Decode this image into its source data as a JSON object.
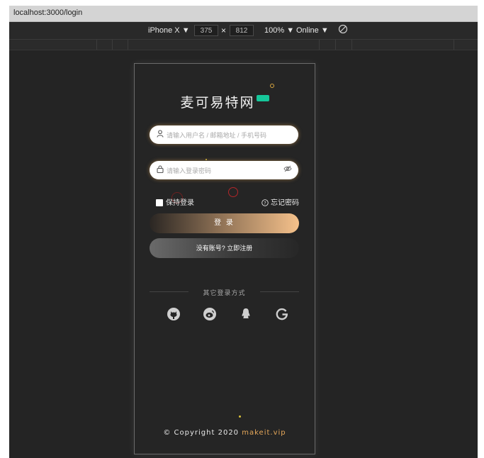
{
  "browser": {
    "url": "localhost:3000/login"
  },
  "devtools": {
    "device": "iPhone X ▼",
    "width": "375",
    "times": "×",
    "height": "812",
    "zoom": "100% ▼",
    "network": "Online ▼"
  },
  "app": {
    "brand": "麦可易特网",
    "username_placeholder": "请输入用户名 / 邮箱地址 / 手机号码",
    "password_placeholder": "请输入登录密码",
    "remember_label": "保持登录",
    "forgot_label": "忘记密码",
    "login_button": "登 录",
    "register_button": "没有账号? 立即注册",
    "other_login": "其它登录方式",
    "social": [
      "github-icon",
      "weibo-icon",
      "qq-icon",
      "google-icon"
    ],
    "footer_prefix": "© Copyright 2020 ",
    "footer_site": "makeit.vip"
  },
  "colors": {
    "accent": "#e6a85a",
    "badge": "#16c79a",
    "page_bg": "#252525"
  }
}
